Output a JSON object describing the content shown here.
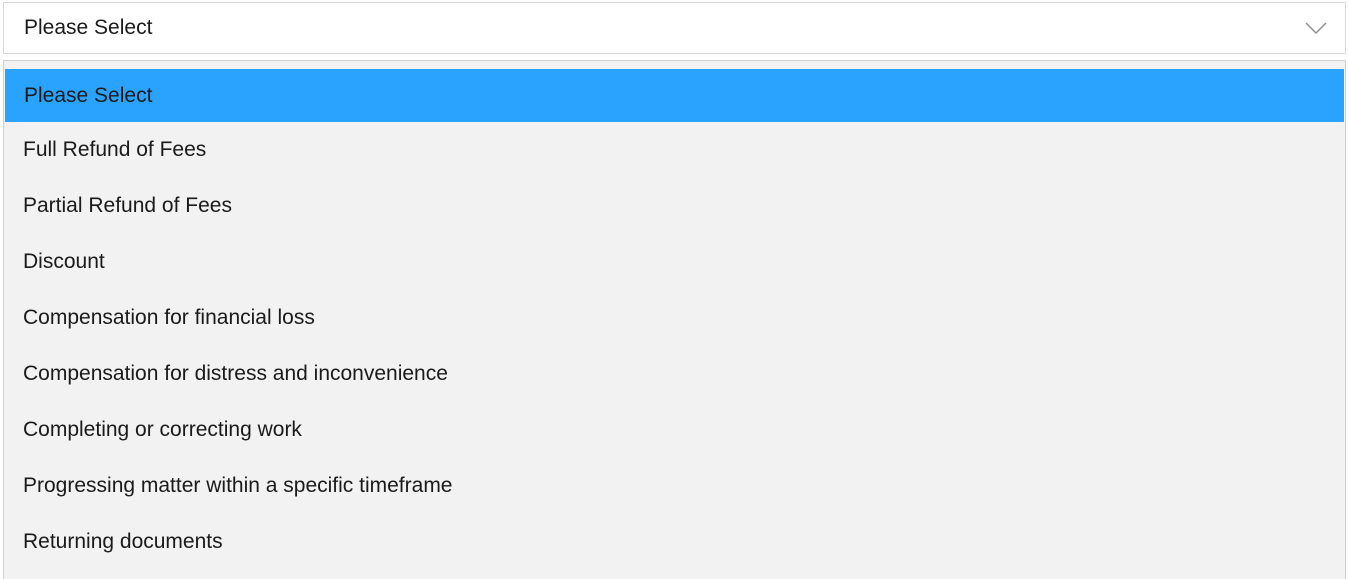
{
  "select": {
    "current_value": "Please Select",
    "icon": "chevron-down-icon"
  },
  "colors": {
    "highlight": "#2aa3ff",
    "list_background": "#f2f2f2"
  },
  "options": [
    {
      "label": "Please Select",
      "selected": true
    },
    {
      "label": "Full Refund of Fees",
      "selected": false
    },
    {
      "label": "Partial Refund of Fees",
      "selected": false
    },
    {
      "label": "Discount",
      "selected": false
    },
    {
      "label": "Compensation for financial loss",
      "selected": false
    },
    {
      "label": "Compensation for distress and inconvenience",
      "selected": false
    },
    {
      "label": "Completing or correcting work",
      "selected": false
    },
    {
      "label": "Progressing matter within a specific timeframe",
      "selected": false
    },
    {
      "label": "Returning documents",
      "selected": false
    }
  ]
}
